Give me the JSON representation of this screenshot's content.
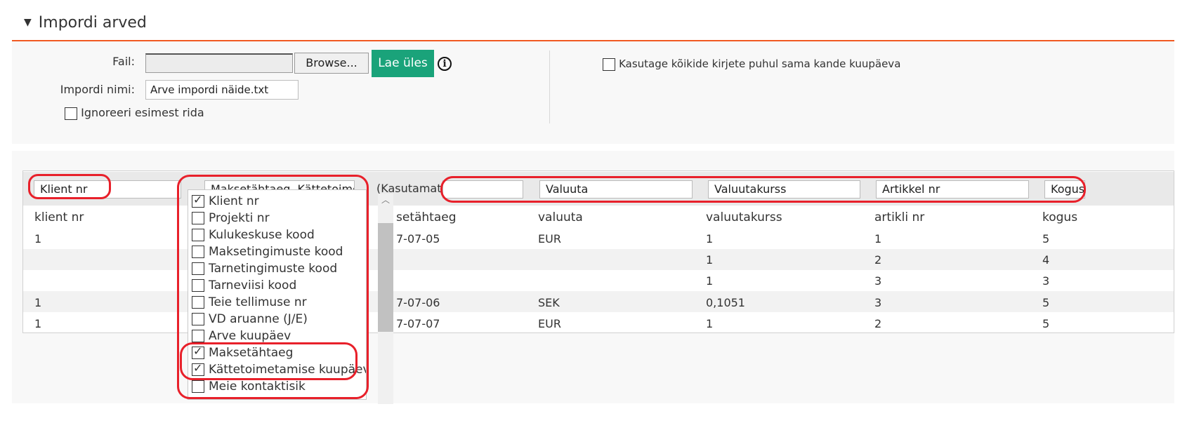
{
  "section": {
    "title": "Impordi arved",
    "toggle_icon": "triangle-down"
  },
  "form": {
    "file_label": "Fail:",
    "file_value": "",
    "browse_label": "Browse...",
    "upload_label": "Lae üles",
    "import_name_label": "Impordi nimi:",
    "import_name_value": "Arve impordi näide.txt",
    "ignore_first_row_label": "Ignoreeri esimest rida",
    "ignore_first_row_checked": false,
    "same_date_label": "Kasutage kõikide kirjete puhul sama kande kuupäeva",
    "same_date_checked": false
  },
  "column_selects": [
    "Klient nr",
    "Maksetähtaeg, Kättetoimeta",
    "(Kasutamata)",
    "",
    "Valuuta",
    "Valuutakurss",
    "Artikkel nr",
    "Kogus"
  ],
  "table": {
    "headers": [
      "klient nr",
      "setähtaeg",
      "valuuta",
      "valuutakurss",
      "artikli nr",
      "kogus"
    ],
    "rows": [
      [
        "1",
        "7-07-05",
        "EUR",
        "1",
        "1",
        "5"
      ],
      [
        "",
        "",
        "",
        "1",
        "2",
        "4"
      ],
      [
        "",
        "",
        "",
        "1",
        "3",
        "3"
      ],
      [
        "1",
        "7-07-06",
        "SEK",
        "0,1051",
        "3",
        "5"
      ],
      [
        "1",
        "7-07-07",
        "EUR",
        "1",
        "2",
        "5"
      ]
    ]
  },
  "dropdown": {
    "items": [
      {
        "label": "Klient nr",
        "checked": true
      },
      {
        "label": "Projekti nr",
        "checked": false
      },
      {
        "label": "Kulukeskuse kood",
        "checked": false
      },
      {
        "label": "Maksetingimuste kood",
        "checked": false
      },
      {
        "label": "Tarnetingimuste kood",
        "checked": false
      },
      {
        "label": "Tarneviisi kood",
        "checked": false
      },
      {
        "label": "Teie tellimuse nr",
        "checked": false
      },
      {
        "label": "VD aruanne (J/E)",
        "checked": false
      },
      {
        "label": "Arve kuupäev",
        "checked": false
      },
      {
        "label": "Maksetähtaeg",
        "checked": true
      },
      {
        "label": "Kättetoimetamise kuupäev",
        "checked": true
      },
      {
        "label": "Meie kontaktisik",
        "checked": false
      }
    ]
  },
  "colors": {
    "accent_orange": "#f15a22",
    "upload_green": "#1aa37a",
    "highlight_red": "#e8202a"
  }
}
